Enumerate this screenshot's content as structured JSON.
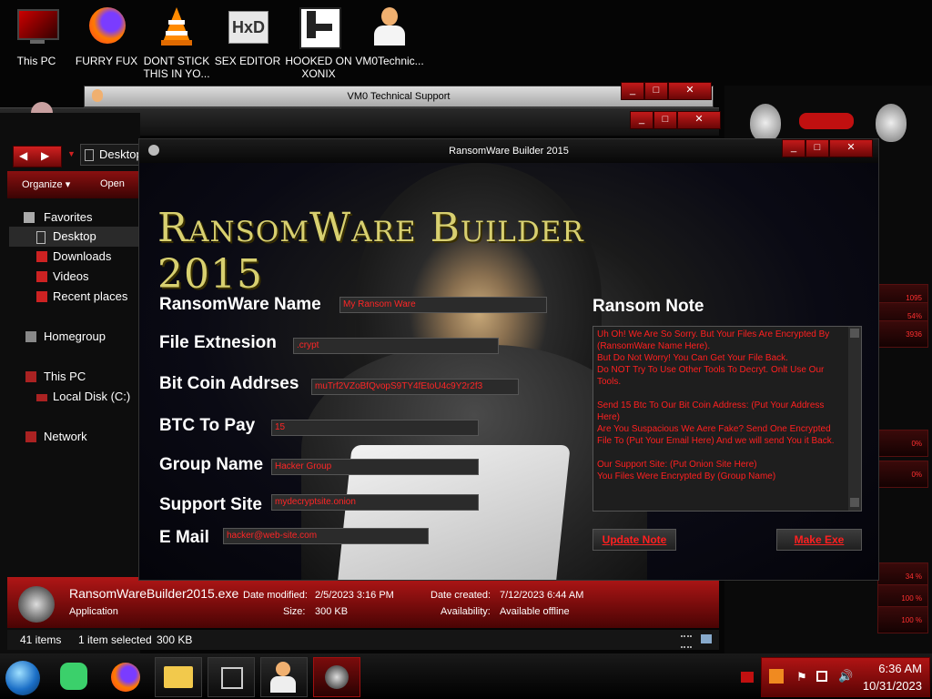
{
  "desktop_icons": [
    {
      "label": "This PC",
      "icon": "monitor-icon"
    },
    {
      "label": "FURRY FUX",
      "icon": "firefox-icon"
    },
    {
      "label": "DONT STICK THIS IN YO...",
      "icon": "vlc-cone-icon"
    },
    {
      "label": "SEX EDITOR",
      "icon": "hxd-icon"
    },
    {
      "label": "HOOKED ON XONIX",
      "icon": "xonix-icon"
    },
    {
      "label": "VM0Technic...",
      "icon": "doctor-icon"
    }
  ],
  "support_window": {
    "title": "VM0 Technical Support"
  },
  "explorer": {
    "address": "Desktop",
    "toolbar": {
      "organize": "Organize",
      "open": "Open"
    },
    "sidebar": [
      {
        "label": "Favorites",
        "icon": "star-icon"
      },
      {
        "label": "Desktop",
        "icon": "desktop-icon"
      },
      {
        "label": "Downloads",
        "icon": "downloads-icon"
      },
      {
        "label": "Videos",
        "icon": "videos-icon"
      },
      {
        "label": "Recent places",
        "icon": "recent-icon"
      },
      {
        "label": "Homegroup",
        "icon": "homegroup-icon"
      },
      {
        "label": "This PC",
        "icon": "computer-icon"
      },
      {
        "label": "Local Disk (C:)",
        "icon": "disk-icon"
      },
      {
        "label": "Network",
        "icon": "network-icon"
      }
    ],
    "details": {
      "filename": "RansomWareBuilder2015.exe",
      "type": "Application",
      "modified_label": "Date modified:",
      "modified": "2/5/2023 3:16 PM",
      "size_label": "Size:",
      "size": "300 KB",
      "created_label": "Date created:",
      "created": "7/12/2023 6:44 AM",
      "availability_label": "Availability:",
      "availability": "Available offline"
    },
    "status": {
      "items": "41 items",
      "selected": "1 item selected",
      "selected_size": "300 KB"
    }
  },
  "app": {
    "title": "RansomWare Builder 2015",
    "banner": "RansomWare Builder 2015",
    "fields": {
      "name": {
        "label": "RansomWare Name",
        "value": "My Ransom Ware"
      },
      "ext": {
        "label": "File Extnesion",
        "value": ".crypt"
      },
      "btc_addr": {
        "label": "Bit Coin Addrses",
        "value": "muTrf2VZoBfQvopS9TY4fEtoU4c9Y2r2f3"
      },
      "btc_pay": {
        "label": "BTC To Pay",
        "value": "15"
      },
      "group": {
        "label": "Group Name",
        "value": "Hacker Group"
      },
      "site": {
        "label": "Support Site",
        "value": "mydecryptsite.onion"
      },
      "email": {
        "label": "E Mail",
        "value": "hacker@web-site.com"
      }
    },
    "note_label": "Ransom Note",
    "note_text": "Uh Oh! We Are So Sorry. But Your Files Are Encrypted By (RansomWare Name Here).\nBut Do Not Worry! You Can Get Your File Back.\nDo NOT Try To Use Other Tools To Decryt. Onlt Use Our Tools.\n\nSend 15 Btc To Our Bit Coin Address: (Put Your Address Here)\nAre You Suspacious We Aere Fake? Send One Encrypted File To (Put Your Email Here) And we will send You it Back.\n\nOur Support Site: (Put Onion Site Here)\nYou Files Were Encrypted By (Group Name)",
    "update_button": "Update Note",
    "make_button": "Make Exe"
  },
  "gadget": {
    "labels": [
      "1095",
      "54%",
      "3936",
      "0%",
      "0%",
      "34 %",
      "100 %",
      "100 %"
    ]
  },
  "taskbar": {
    "time": "6:36 AM",
    "date": "10/31/2023"
  },
  "colors": {
    "accent": "#d01515",
    "text_red": "#ff2020",
    "banner": "#d8d070"
  }
}
